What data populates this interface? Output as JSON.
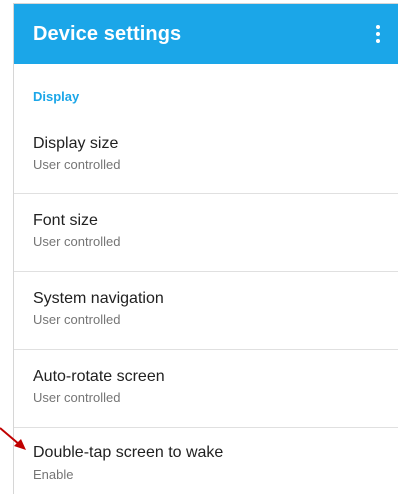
{
  "app_bar": {
    "title": "Device settings",
    "menu_icon": "more-vertical-icon",
    "color": "#1ba6e8"
  },
  "section": {
    "header": "Display"
  },
  "items": [
    {
      "title": "Display size",
      "subtitle": "User controlled"
    },
    {
      "title": "Font size",
      "subtitle": "User controlled"
    },
    {
      "title": "System navigation",
      "subtitle": "User controlled"
    },
    {
      "title": "Auto-rotate screen",
      "subtitle": "User controlled"
    },
    {
      "title": "Double-tap screen to wake",
      "subtitle": "Enable"
    }
  ],
  "annotation": {
    "icon": "red-arrow-icon",
    "color": "#c00000"
  }
}
